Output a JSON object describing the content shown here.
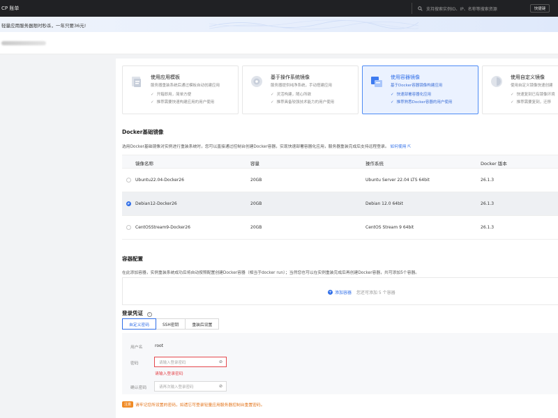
{
  "topbar": {
    "brand": "CP 账单",
    "search_placeholder": "支持搜索实例ID、IP、名称等搜索资源",
    "quick_label": "快捷键"
  },
  "promo": {
    "text": "轻量应用服务器限时秒杀，一年只要36元!"
  },
  "image_cards": [
    {
      "title": "使用应用模板",
      "desc": "服务器重装系统后通过模板自动创建应用",
      "features": [
        "开箱即用，简单方便",
        "推荐需要快速构建应用的用户使用"
      ],
      "icon": "app-template-icon"
    },
    {
      "title": "基于操作系统镜像",
      "desc": "服务器提供纯净系统，手动搭建应用",
      "features": [
        "灵活构建，随心所欲",
        "推荐具备较强技术能力的用户使用"
      ],
      "icon": "os-image-icon"
    },
    {
      "title": "使用容器镜像",
      "desc": "基于Docker容器镜像构建应用",
      "features": [
        "快速部署容器化应用",
        "推荐熟悉Docker容器的用户使用"
      ],
      "icon": "container-image-icon"
    },
    {
      "title": "使用自定义镜像",
      "desc": "使用自定义镜像快速创建",
      "features": [
        "快速复刻已有镜像环境",
        "推荐需要复刻，迁移"
      ],
      "icon": "custom-image-icon"
    }
  ],
  "docker": {
    "title": "Docker基础镜像",
    "desc": "选用Docker基础镜像对实例进行重装系统时，您可以直接通过控制台创建Docker容器，实现快速部署容器化应用，服务器重装完成后支持远程登录。",
    "link": "如何使用",
    "columns": [
      "镜像名称",
      "容量",
      "操作系统",
      "Docker 版本"
    ],
    "rows": [
      {
        "name": "Ubuntu22.04-Docker26",
        "capacity": "20GB",
        "os": "Ubuntu Server 22.04 LTS 64bit",
        "version": "26.1.3"
      },
      {
        "name": "Debian12-Docker26",
        "capacity": "20GB",
        "os": "Debian 12.0 64bit",
        "version": "26.1.3"
      },
      {
        "name": "CentOSStream9-Docker26",
        "capacity": "20GB",
        "os": "CentOS Stream 9 64bit",
        "version": "26.1.3"
      }
    ]
  },
  "container": {
    "title": "容器配置",
    "desc": "在此添加容器，实例重装系统成功后将自动按照配置创建Docker容器（相当于docker run）；当然您也可以在实例重装完成后再创建Docker容器，共可添加5个容器。",
    "add_label": "添加容器",
    "add_hint": "您还可添加 5 个容器"
  },
  "login": {
    "title": "登录凭证",
    "tabs": [
      "自定义密码",
      "SSH密钥",
      "重装后设置"
    ],
    "username_label": "用户名",
    "username_value": "root",
    "password_label": "密码",
    "password_placeholder": "请输入登录密码",
    "password_error": "请输入登录密码",
    "confirm_label": "确认密码",
    "confirm_placeholder": "请再次输入登录密码",
    "warn_tag": "注意",
    "warn_text": "请牢记您所设置的密码，如遗忘可登录轻量应用服务器控制台重置密码。"
  },
  "colors": {
    "accent": "#2f6ee8",
    "error": "#e5484d",
    "warn": "#e37318"
  }
}
